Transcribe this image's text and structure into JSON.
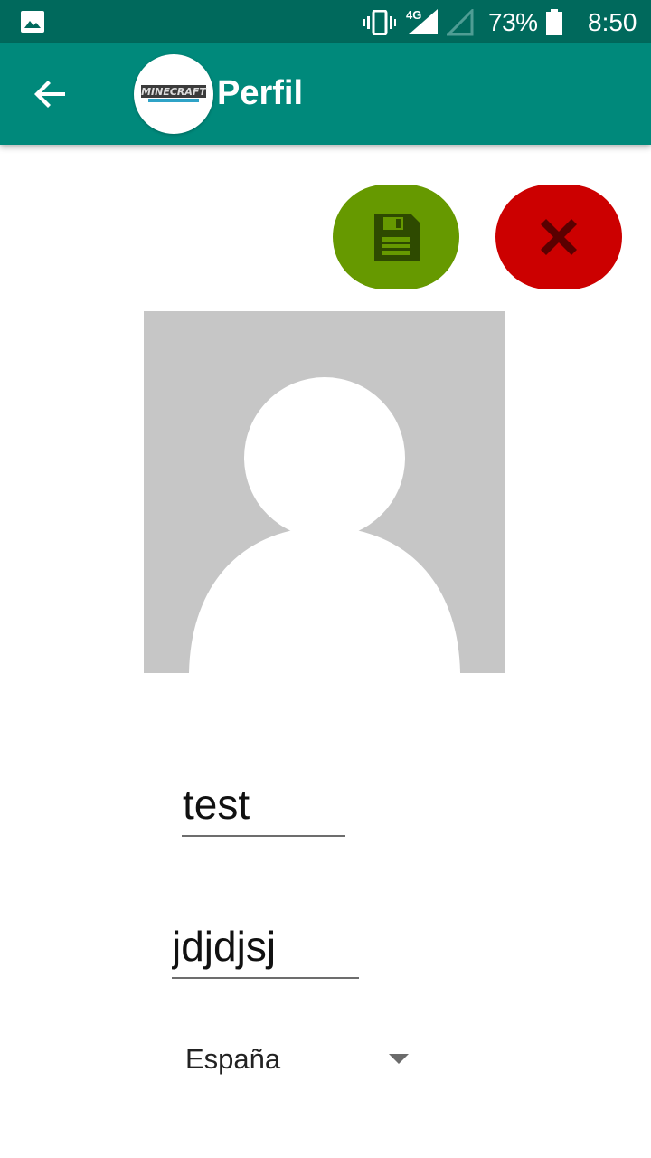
{
  "status_bar": {
    "network_type": "4G",
    "battery_percent": "73%",
    "time": "8:50",
    "icons": [
      "gallery-icon",
      "vibrate-icon",
      "signal-icon",
      "signal-empty-icon",
      "battery-icon"
    ]
  },
  "app_bar": {
    "title": "Perfil",
    "logo_text": "MINECRAFT",
    "color": "#00897b",
    "status_color": "#00695c"
  },
  "actions": {
    "save_icon": "floppy-disk-icon",
    "save_color": "#669900",
    "cancel_icon": "close-icon",
    "cancel_color": "#cc0000"
  },
  "profile": {
    "photo_icon": "default-avatar-icon"
  },
  "form": {
    "name_value": "test",
    "surname_value": "jdjdjsj",
    "country_selected": "España"
  }
}
